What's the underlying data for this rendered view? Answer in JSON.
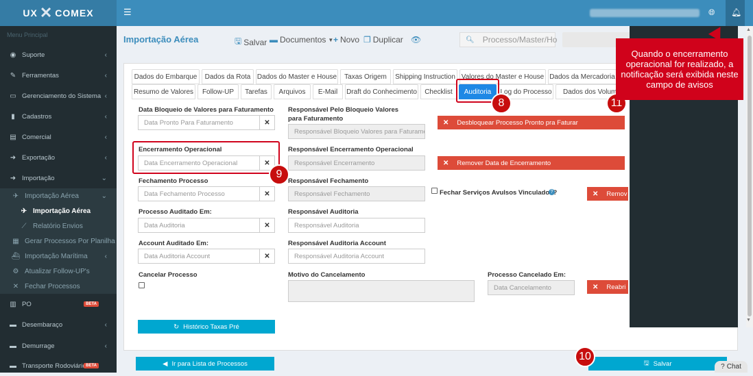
{
  "header": {
    "logo_left": "UX",
    "logo_x": "✕",
    "logo_right": "COMEX",
    "menu_icon": "bars-icon",
    "globe_icon": "globe-icon",
    "bell_icon": "bell-icon"
  },
  "sidebar": {
    "header": "Menu Principal",
    "items": [
      {
        "label": "Suporte",
        "icon": "life-ring-icon"
      },
      {
        "label": "Ferramentas",
        "icon": "wrench-icon"
      },
      {
        "label": "Gerenciamento do Sistema",
        "icon": "laptop-icon"
      },
      {
        "label": "Cadastros",
        "icon": "book-icon"
      },
      {
        "label": "Comercial",
        "icon": "database-icon"
      },
      {
        "label": "Exportação",
        "icon": "arrow-circle-icon"
      },
      {
        "label": "Importação",
        "icon": "arrow-circle-icon"
      }
    ],
    "sub_items": [
      {
        "label": "Importação Aérea",
        "icon": "plane-icon"
      },
      {
        "label": "Importação Aérea",
        "icon": "plane-icon"
      },
      {
        "label": "Relatório Envios",
        "icon": "chart-icon"
      },
      {
        "label": "Gerar Processos Por Planilha",
        "icon": "file-icon"
      },
      {
        "label": "Importação Marítima",
        "icon": "ship-icon"
      },
      {
        "label": "Atualizar Follow-UP's",
        "icon": "cog-icon"
      },
      {
        "label": "Fechar Processos",
        "icon": "times-icon"
      }
    ],
    "bottom_items": [
      {
        "label": "PO",
        "icon": "bar-chart-icon",
        "badge": "BETA"
      },
      {
        "label": "Desembaraço",
        "icon": "folder-icon"
      },
      {
        "label": "Demurrage",
        "icon": "clock-icon"
      },
      {
        "label": "Transporte Rodoviário",
        "icon": "truck-icon",
        "badge": "BETA"
      }
    ]
  },
  "toolbar": {
    "title": "Importação Aérea",
    "save": "Salvar",
    "documents": "Documentos",
    "new": "Novo",
    "duplicate": "Duplicar",
    "search_placeholder": "Processo/Master/Ho"
  },
  "tabs_row1": [
    "Dados do Embarque",
    "Dados da Rota",
    "Dados do Master e House",
    "Taxas Origem",
    "Shipping Instruction",
    "Valores do Master e House",
    "Dados da Mercadoria"
  ],
  "tabs_row2": [
    "Resumo de Valores",
    "Follow-UP",
    "Tarefas",
    "Arquivos",
    "E-Mail",
    "Draft do Conhecimento",
    "Checklist",
    "Auditoria",
    "Log do Processo",
    "Dados dos Volume"
  ],
  "form": {
    "bloqueio_label": "Data Bloqueio de Valores para Faturamento",
    "bloqueio_placeholder": "Data Pronto Para Faturamento",
    "resp_bloqueio_label": "Responsável Pelo Bloqueio Valores para Faturamento",
    "resp_bloqueio_placeholder": "Responsável Bloqueio Valores para Faturamer",
    "desbloquear_btn": "Desbloquear Processo Pronto pra Faturar",
    "encerramento_label": "Encerramento Operacional",
    "encerramento_placeholder": "Data Encerramento Operacional",
    "resp_encerramento_label": "Responsável Encerramento Operacional",
    "resp_encerramento_placeholder": "Responsável Encerramento",
    "remover_encerramento_btn": "Remover Data de Encerramento",
    "fechamento_label": "Fechamento Processo",
    "fechamento_placeholder": "Data Fechamento Processo",
    "resp_fechamento_label": "Responsável Fechamento",
    "resp_fechamento_placeholder": "Responsável Fechamento",
    "fechar_servicos_label": "Fechar Serviços Avulsos Vinculados?",
    "remover_btn": "Remov",
    "auditado_label": "Processo Auditado Em:",
    "auditado_placeholder": "Data Auditoria",
    "resp_auditoria_label": "Responsável Auditoria",
    "resp_auditoria_placeholder": "Responsável Auditoria",
    "account_label": "Account Auditado Em:",
    "account_placeholder": "Data Auditoria Account",
    "resp_account_label": "Responsável Auditoria Account",
    "resp_account_placeholder": "Responsável Auditoria Account",
    "cancelar_label": "Cancelar Processo",
    "motivo_label": "Motivo do Cancelamento",
    "cancelado_label": "Processo Cancelado Em:",
    "cancelado_placeholder": "Data Cancelamento",
    "reabrir_btn": "Reabri",
    "historico_btn": "Histórico Taxas Pré",
    "lista_btn": "Ir para Lista de Processos",
    "salvar_btn": "Salvar"
  },
  "annotations": {
    "badge_8": "8",
    "badge_9": "9",
    "badge_10": "10",
    "badge_11": "11",
    "callout": "Quando o encerramento operacional for realizado, a notificação será exibida neste campo de avisos"
  },
  "chat_label": "Chat",
  "colors": {
    "brand": "#3c8dbc",
    "danger": "#dd4b39",
    "info": "#00a7d0",
    "sidebar": "#222d32"
  }
}
